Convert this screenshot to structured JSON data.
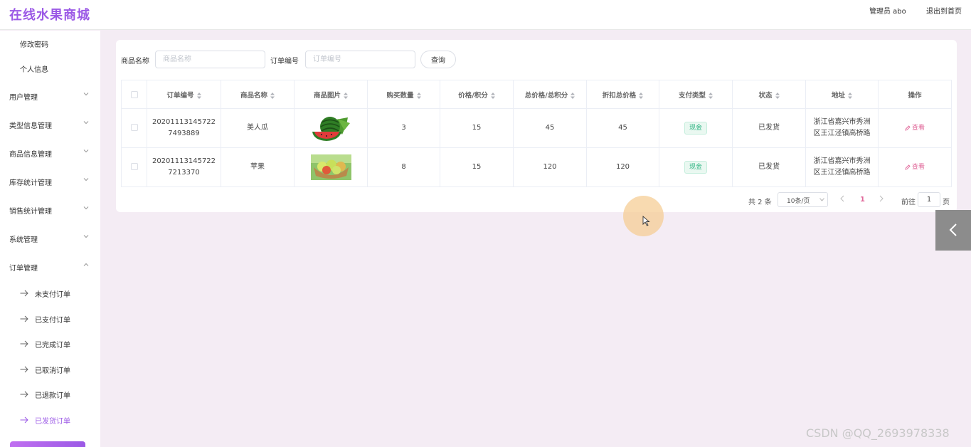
{
  "header": {
    "brand": "在线水果商城",
    "admin": "管理员 abo",
    "exit": "退出到首页"
  },
  "sidebar": {
    "items": [
      {
        "label": "修改密码",
        "type": "sub"
      },
      {
        "label": "个人信息",
        "type": "sub"
      },
      {
        "label": "用户管理",
        "type": "group",
        "expanded": false
      },
      {
        "label": "类型信息管理",
        "type": "group",
        "expanded": false
      },
      {
        "label": "商品信息管理",
        "type": "group",
        "expanded": false
      },
      {
        "label": "库存统计管理",
        "type": "group",
        "expanded": false
      },
      {
        "label": "销售统计管理",
        "type": "group",
        "expanded": false
      },
      {
        "label": "系统管理",
        "type": "group",
        "expanded": false
      },
      {
        "label": "订单管理",
        "type": "group",
        "expanded": true
      },
      {
        "label": "未支付订单",
        "type": "child"
      },
      {
        "label": "已支付订单",
        "type": "child"
      },
      {
        "label": "已完成订单",
        "type": "child"
      },
      {
        "label": "已取消订单",
        "type": "child"
      },
      {
        "label": "已退款订单",
        "type": "child"
      },
      {
        "label": "已发货订单",
        "type": "child",
        "active": true
      }
    ]
  },
  "filters": {
    "product_label": "商品名称",
    "product_placeholder": "商品名称",
    "order_label": "订单编号",
    "order_placeholder": "订单编号",
    "query_button": "查询"
  },
  "table": {
    "columns": [
      "订单编号",
      "商品名称",
      "商品图片",
      "购买数量",
      "价格/积分",
      "总价格/总积分",
      "折扣总价格",
      "支付类型",
      "状态",
      "地址",
      "操作"
    ],
    "rows": [
      {
        "order_no": "202011131457227493889",
        "product": "美人瓜",
        "image": "watermelon",
        "qty": "3",
        "price": "15",
        "total": "45",
        "discount_total": "45",
        "pay_type": "现金",
        "status": "已发货",
        "address": "浙江省嘉兴市秀洲区王江泾镇高桥路",
        "action": "查看"
      },
      {
        "order_no": "202011131457227213370",
        "product": "苹果",
        "image": "apple-basket",
        "qty": "8",
        "price": "15",
        "total": "120",
        "discount_total": "120",
        "pay_type": "现金",
        "status": "已发货",
        "address": "浙江省嘉兴市秀洲区王江泾镇高桥路",
        "action": "查看"
      }
    ]
  },
  "pagination": {
    "total": "共 2 条",
    "page_size": "10条/页",
    "current": "1",
    "goto_label": "前往",
    "goto_value": "1",
    "page_suffix": "页"
  },
  "watermark": "CSDN @QQ_2693978338",
  "colors": {
    "accent": "#9b59e6",
    "link": "#e0689a",
    "tag": "#2db482",
    "background": "#f4ecf4"
  }
}
